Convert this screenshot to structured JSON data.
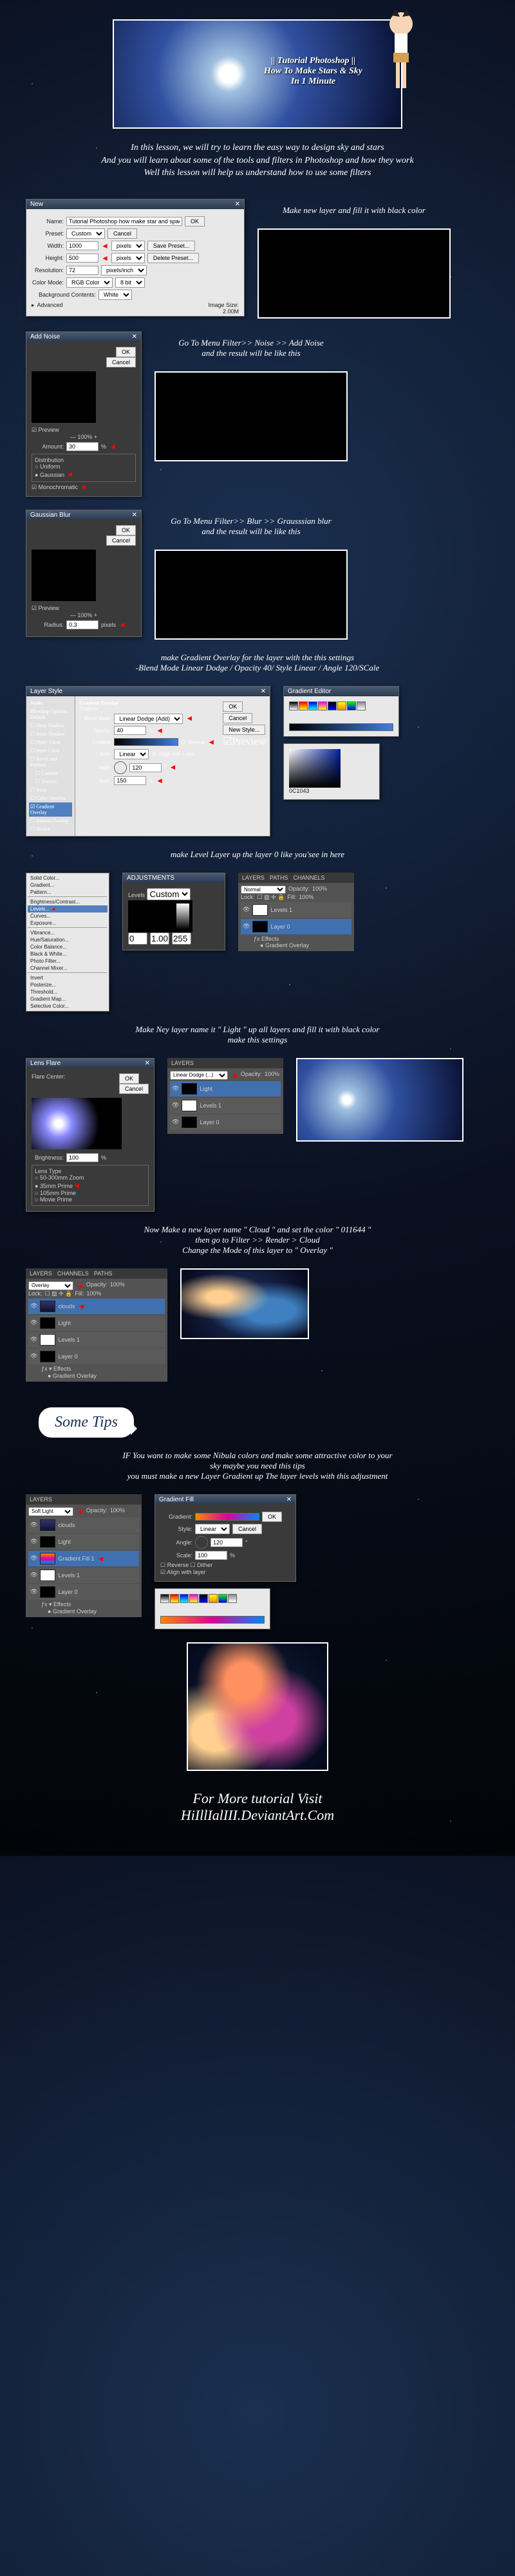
{
  "banner": {
    "title_line1": "|| Tutorial Photoshop ||",
    "title_line2": "How To Make Stars & Sky",
    "title_line3": "In 1 Minute"
  },
  "intro": {
    "line1": "In this lesson, we will try to learn the easy way to design sky and stars",
    "line2": "And you will learn about some of the tools and filters in Photoshop and how they work",
    "line3": "Well this lesson will help us understand how to use some filters"
  },
  "step1": {
    "caption": "Make new layer and fill it with black color",
    "dialog_title": "New",
    "name_label": "Name:",
    "name_value": "Tutorial Photoshop how make star and space",
    "preset_label": "Preset:",
    "preset_value": "Custom",
    "width_label": "Width:",
    "width_value": "1000",
    "width_unit": "pixels",
    "height_label": "Height:",
    "height_value": "500",
    "height_unit": "pixels",
    "resolution_label": "Resolution:",
    "resolution_value": "72",
    "resolution_unit": "pixels/inch",
    "colormode_label": "Color Mode:",
    "colormode_value": "RGB Color",
    "colormode_bits": "8 bit",
    "bg_label": "Background Contents:",
    "bg_value": "White",
    "advanced": "Advanced",
    "ok": "OK",
    "cancel": "Cancel",
    "save_preset": "Save Preset...",
    "delete_preset": "Delete Preset...",
    "image_size_label": "Image Size:",
    "image_size_value": "2.00M"
  },
  "step2": {
    "caption_line1": "Go To Menu Filter>> Noise >> Add Noise",
    "caption_line2": "and the result will be like this",
    "dialog_title": "Add Noise",
    "amount_label": "Amount:",
    "amount_value": "30",
    "amount_unit": "%",
    "distribution": "Distribution",
    "uniform": "Uniform",
    "gaussian": "Gaussian",
    "monochromatic": "Monochromatic",
    "ok": "OK",
    "cancel": "Cancel",
    "preview": "Preview"
  },
  "step3": {
    "caption_line1": "Go To Menu Filter>> Blur >> Grausssian blur",
    "caption_line2": "and the result will be like this",
    "dialog_title": "Gaussian Blur",
    "radius_label": "Radius:",
    "radius_value": "0.3",
    "radius_unit": "pixels",
    "ok": "OK",
    "cancel": "Cancel",
    "preview": "Preview"
  },
  "step4": {
    "caption_line1": "make Gradient Overlay for the layer with the this settings",
    "caption_line2": "-Blend Mode Linear Dodge / Opacity 40/ Style Linear  / Angle 120/SCale",
    "dialog_title": "Layer Style",
    "styles": "Styles",
    "blending_options": "Blending Options: Default",
    "drop_shadow": "Drop Shadow",
    "inner_shadow": "Inner Shadow",
    "outer_glow": "Outer Glow",
    "inner_glow": "Inner Glow",
    "bevel": "Bevel and Emboss",
    "contour": "Contour",
    "texture": "Texture",
    "satin": "Satin",
    "color_overlay": "Color Overlay",
    "gradient_overlay": "Gradient Overlay",
    "pattern_overlay": "Pattern Overlay",
    "stroke": "Stroke",
    "go_heading": "Gradient Overlay",
    "go_gradient": "Gradient",
    "go_blend": "Blend Mode:",
    "go_blend_val": "Linear Dodge (Add)",
    "go_opacity": "Opacity:",
    "go_opacity_val": "40",
    "go_gradient_label": "Gradient:",
    "go_reverse": "Reverse",
    "go_style": "Style:",
    "go_style_val": "Linear",
    "go_align": "Align with Layer",
    "go_angle": "Angle:",
    "go_angle_val": "120",
    "go_scale": "Scale:",
    "go_scale_val": "150",
    "ok": "OK",
    "cancel": "Cancel",
    "new_style": "New Style...",
    "preview": "Preview",
    "grad_title": "Gradient Editor",
    "color_hex": "0C1043"
  },
  "step5": {
    "caption": "make Level Layer up   the layer 0 like you'see in here",
    "menu_items": [
      "Solid Color...",
      "Gradient...",
      "Pattern...",
      "Brightness/Contrast...",
      "Levels...",
      "Curves...",
      "Exposure...",
      "Vibrance...",
      "Hue/Saturation...",
      "Color Balance...",
      "Black & White...",
      "Photo Filter...",
      "Channel Mixer...",
      "Invert",
      "Posterize...",
      "Threshold...",
      "Gradient Map...",
      "Selective Color..."
    ],
    "levels_title": "ADJUSTMENTS",
    "levels_label": "Levels",
    "levels_custom": "Custom",
    "layers_title": "LAYERS",
    "paths": "PATHS",
    "channels": "CHANNELS",
    "normal": "Normal",
    "opacity": "Opacity:",
    "opacity_val": "100%",
    "lock": "Lock:",
    "fill": "Fill:",
    "fill_val": "100%",
    "layer_levels": "Levels 1",
    "layer_0": "Layer 0",
    "effects": "Effects",
    "go_fx": "Gradient Overlay"
  },
  "step6": {
    "caption_line1": "Make Ney layer name it \" Light \" up all layers and fill it with black color",
    "caption_line2": "make this settings",
    "dialog_title": "Lens Flare",
    "flare_center": "Flare Center:",
    "brightness": "Brightness:",
    "brightness_val": "100",
    "lens_type": "Lens Type",
    "lens_50_300": "50-300mm Zoom",
    "lens_35": "35mm Prime",
    "lens_105": "105mm Prime",
    "lens_movie": "Movie Prime",
    "ok": "OK",
    "cancel": "Cancel",
    "layer_light": "Light",
    "layers_title": "LAYERS",
    "layer_levels": "Levels 1",
    "layer_0": "Layer 0",
    "linear_dodge": "Linear Dodge (...)",
    "opacity": "Opacity:",
    "opacity_val": "100%"
  },
  "step7": {
    "caption_line1": "Now Make a new layer name \" Cloud \" and set the color  \" 011644 \"",
    "caption_line2": "then go to Filter >> Render > Cloud",
    "caption_line3": "Change the Mode of this layer to \" Overlay \"",
    "layers_title": "LAYERS",
    "channels": "CHANNELS",
    "paths": "PATHS",
    "overlay": "Overlay",
    "opacity": "Opacity:",
    "opacity_val": "100%",
    "lock": "Lock:",
    "fill": "Fill:",
    "fill_val": "100%",
    "layer_clouds": "clouds",
    "layer_light": "Light",
    "layer_levels": "Levels 1",
    "layer_0": "Layer 0",
    "effects": "Effects",
    "go_fx": "Gradient Overlay"
  },
  "tips": {
    "label": "Some Tips",
    "line1": "IF You want to make some Nibula colors and make some attractive color to your",
    "line2": "sky maybe you need this tips",
    "line3": "you must make a new Layer Gradient up The layer levels with this adjustment",
    "grad_title": "Gradient Fill",
    "grad_label": "Gradient:",
    "grad_style": "Style:",
    "grad_style_val": "Linear",
    "grad_angle": "Angle:",
    "grad_angle_val": "120",
    "grad_scale": "Scale:",
    "grad_scale_val": "100",
    "grad_reverse": "Reverse",
    "grad_dither": "Dither",
    "grad_align": "Align with layer",
    "ok": "OK",
    "cancel": "Cancel",
    "layers_title": "LAYERS",
    "soft_light": "Soft Light",
    "opacity": "Opacity:",
    "opacity_val": "100%",
    "layer_clouds": "clouds",
    "layer_light": "Light",
    "layer_gradfill": "Gradient Fill 1",
    "layer_levels": "Levels 1",
    "layer_0": "Layer 0",
    "effects": "Effects",
    "go_fx": "Gradient Overlay"
  },
  "footer": {
    "line1": "For More tutorial Visit",
    "line2": "HiIllIalIII.DeviantArt.Com"
  }
}
